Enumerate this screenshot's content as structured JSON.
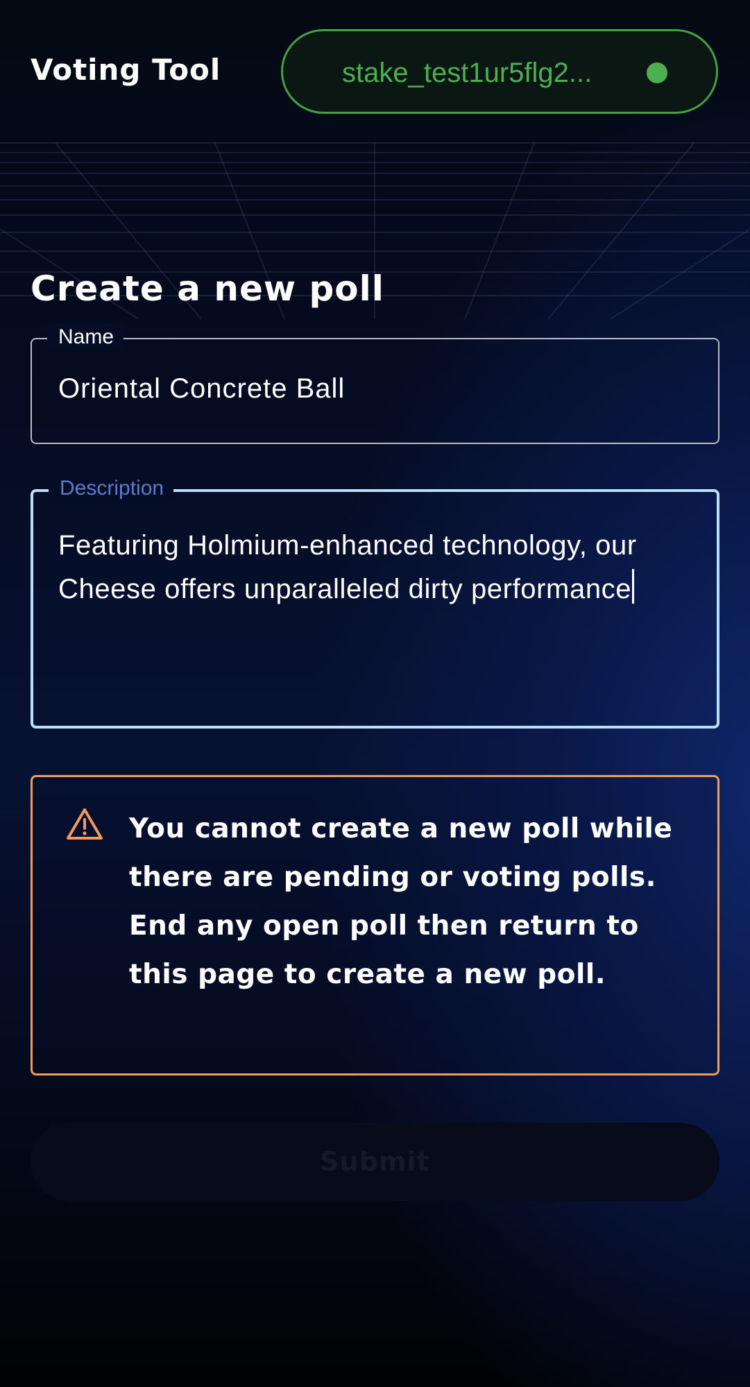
{
  "header": {
    "app_title": "Voting Tool",
    "wallet_address": "stake_test1ur5flg2...",
    "wallet_status_color": "#4caf50"
  },
  "page": {
    "title": "Create a new poll"
  },
  "form": {
    "name": {
      "label": "Name",
      "value": "Oriental Concrete Ball"
    },
    "description": {
      "label": "Description",
      "value": "Featuring Holmium-enhanced technology, our Cheese offers unparalleled dirty performance"
    }
  },
  "warning": {
    "icon": "warning-triangle-icon",
    "color": "#f29b5a",
    "message": "You cannot create a new poll while there are pending or voting polls. End any open poll then return to this page to create a new poll."
  },
  "submit": {
    "label": "Submit",
    "disabled": true
  }
}
